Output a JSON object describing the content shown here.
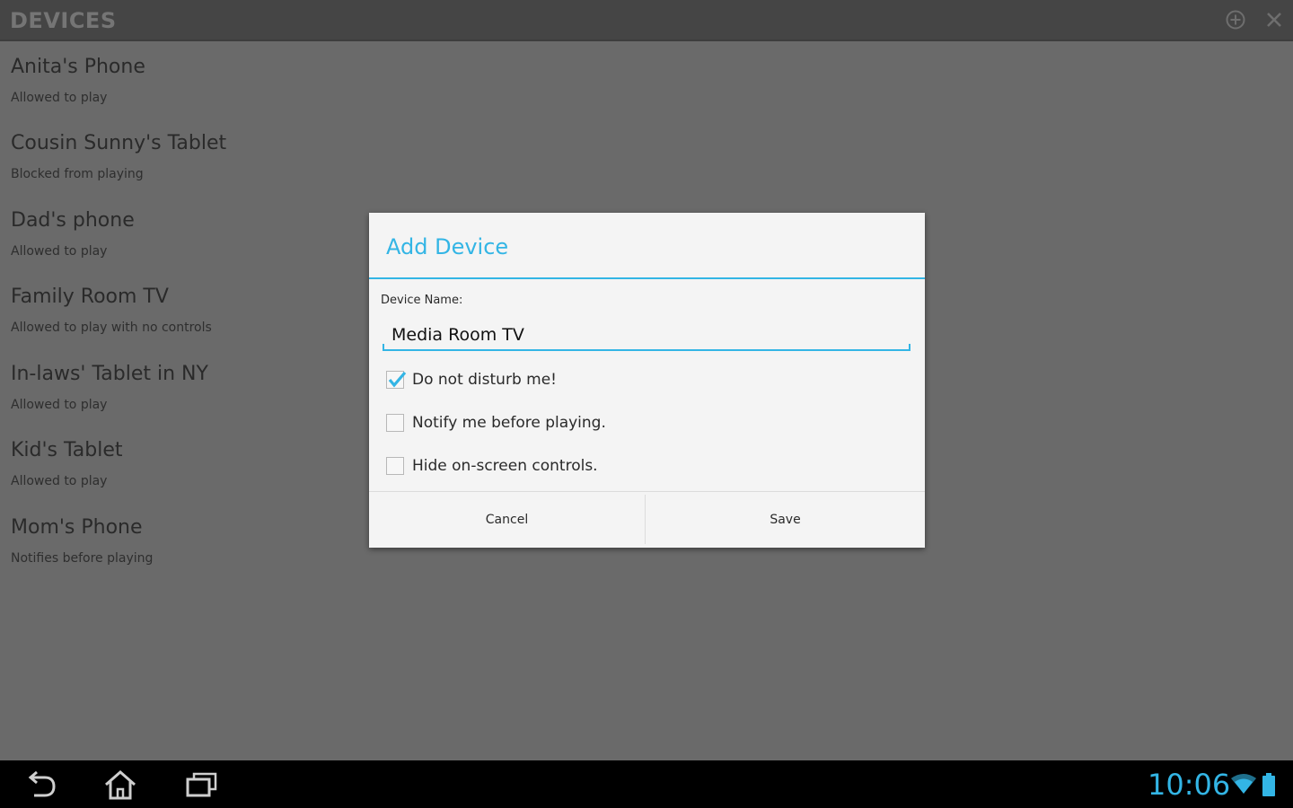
{
  "action_bar": {
    "title": "DEVICES",
    "add_icon": "add-circle-icon",
    "close_icon": "close-icon"
  },
  "devices": [
    {
      "name": "Anita's Phone",
      "status": "Allowed to play"
    },
    {
      "name": "Cousin Sunny's Tablet",
      "status": "Blocked from playing"
    },
    {
      "name": "Dad's phone",
      "status": "Allowed to play"
    },
    {
      "name": "Family Room TV",
      "status": "Allowed to play with no controls"
    },
    {
      "name": "In-laws' Tablet in NY",
      "status": "Allowed to play"
    },
    {
      "name": "Kid's Tablet",
      "status": "Allowed to play"
    },
    {
      "name": "Mom's Phone",
      "status": "Notifies before playing"
    }
  ],
  "dialog": {
    "title": "Add Device",
    "field_label": "Device Name:",
    "device_name_value": "Media Room TV",
    "options": [
      {
        "label": "Do not disturb me!",
        "checked": true
      },
      {
        "label": "Notify me before playing.",
        "checked": false
      },
      {
        "label": "Hide on-screen controls.",
        "checked": false
      }
    ],
    "cancel_label": "Cancel",
    "save_label": "Save"
  },
  "nav_bar": {
    "back_icon": "back-icon",
    "home_icon": "home-icon",
    "recents_icon": "recent-apps-icon",
    "clock": "10:06",
    "wifi_icon": "wifi-icon",
    "battery_icon": "battery-icon"
  },
  "colors": {
    "accent": "#33b5e5",
    "overlay_bg": "#6a6a6a",
    "action_bar_bg": "#454545",
    "dialog_bg": "#f4f4f4",
    "nav_bar_bg": "#000000"
  }
}
